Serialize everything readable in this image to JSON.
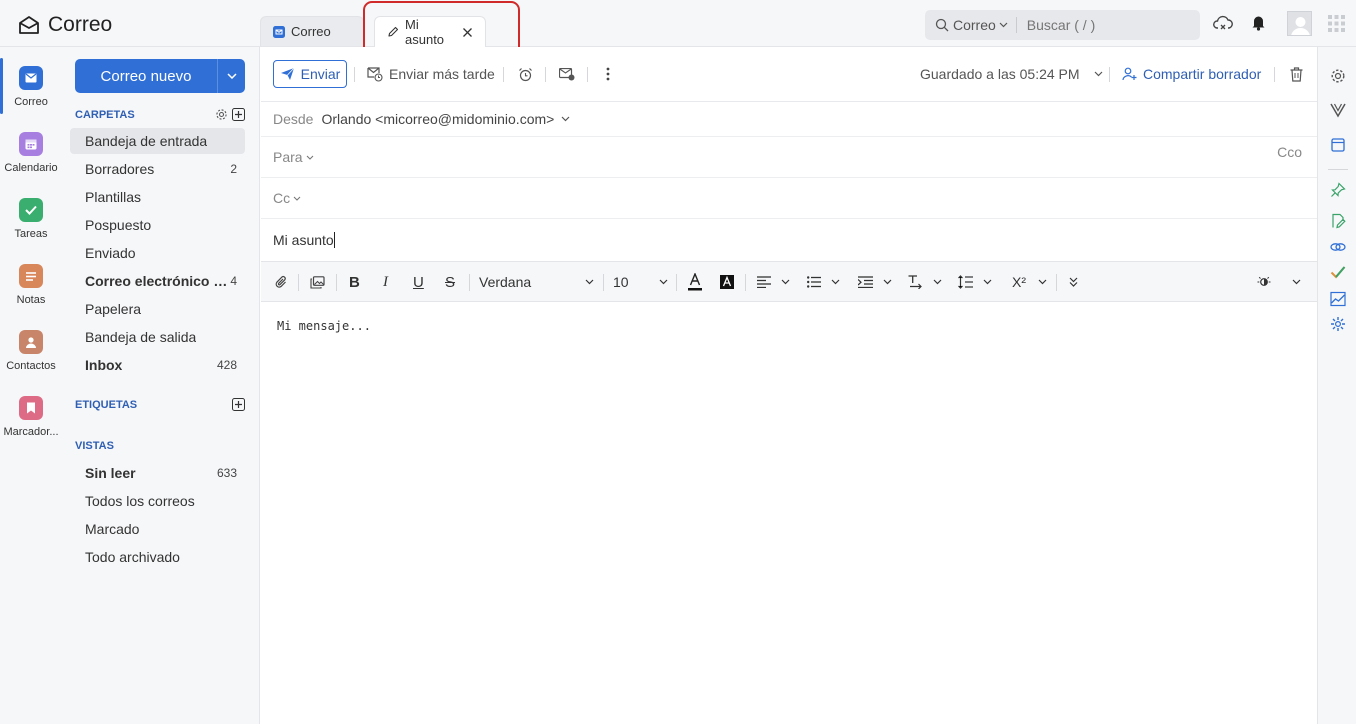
{
  "app": {
    "title": "Correo"
  },
  "tabs": [
    {
      "label": "Correo"
    },
    {
      "label": "Mi asunto"
    }
  ],
  "search": {
    "scope": "Correo",
    "placeholder": "Buscar ( / )"
  },
  "apps": [
    {
      "label": "Correo",
      "icon": "mail-icon",
      "color": "#2f6fd6"
    },
    {
      "label": "Calendario",
      "icon": "calendar-icon",
      "color": "#a77fe0"
    },
    {
      "label": "Tareas",
      "icon": "check-icon",
      "color": "#3aae6e"
    },
    {
      "label": "Notas",
      "icon": "notes-icon",
      "color": "#d8875a"
    },
    {
      "label": "Contactos",
      "icon": "contact-icon",
      "color": "#c9856a"
    },
    {
      "label": "Marcador...",
      "icon": "bookmark-icon",
      "color": "#de6b86"
    }
  ],
  "sidebar": {
    "new_mail": "Correo nuevo",
    "folders_header": "CARPETAS",
    "folders": [
      {
        "label": "Bandeja de entrada",
        "count": ""
      },
      {
        "label": "Borradores",
        "count": "2"
      },
      {
        "label": "Plantillas",
        "count": ""
      },
      {
        "label": "Pospuesto",
        "count": ""
      },
      {
        "label": "Enviado",
        "count": ""
      },
      {
        "label": "Correo electrónico no deseado",
        "count": "4"
      },
      {
        "label": "Papelera",
        "count": ""
      },
      {
        "label": "Bandeja de salida",
        "count": ""
      },
      {
        "label": "Inbox",
        "count": "428"
      }
    ],
    "labels_header": "ETIQUETAS",
    "views_header": "VISTAS",
    "views": [
      {
        "label": "Sin leer",
        "count": "633"
      },
      {
        "label": "Todos los correos",
        "count": ""
      },
      {
        "label": "Marcado",
        "count": ""
      },
      {
        "label": "Todo archivado",
        "count": ""
      }
    ]
  },
  "toolbar": {
    "send": "Enviar",
    "send_later": "Enviar más tarde",
    "saved": "Guardado a las 05:24 PM",
    "share_draft": "Compartir borrador"
  },
  "compose": {
    "from_label": "Desde",
    "from_value": "Orlando <micorreo@midominio.com>",
    "to_label": "Para",
    "bcc_label": "Cco",
    "cc_label": "Cc",
    "subject": "Mi asunto",
    "font": "Verdana",
    "size": "10",
    "body": "Mi mensaje..."
  },
  "colors": {
    "accent": "#2f6fd6",
    "highlight": "#d02a2a"
  }
}
